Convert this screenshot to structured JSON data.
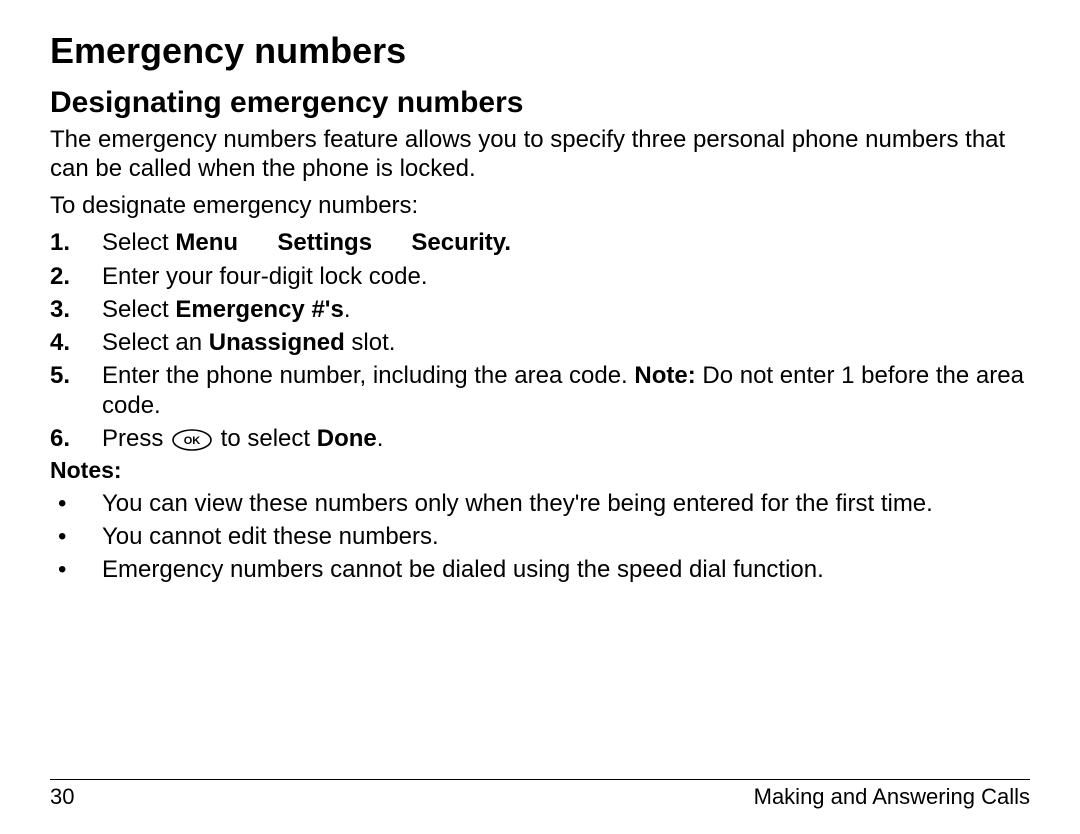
{
  "heading": "Emergency numbers",
  "subheading": "Designating emergency numbers",
  "intro1": "The emergency numbers feature allows you to specify three personal phone numbers that can be called when the phone is locked.",
  "intro2": "To designate emergency numbers:",
  "steps": [
    {
      "n": "1.",
      "parts": [
        {
          "t": "Select ",
          "b": false
        },
        {
          "t": "Menu",
          "b": true
        },
        {
          "t": "Settings",
          "b": true,
          "arrowBefore": true
        },
        {
          "t": "Security.",
          "b": true,
          "arrowBefore": true
        }
      ]
    },
    {
      "n": "2.",
      "parts": [
        {
          "t": "Enter your four-digit lock code.",
          "b": false
        }
      ]
    },
    {
      "n": "3.",
      "parts": [
        {
          "t": "Select ",
          "b": false
        },
        {
          "t": "Emergency #'s",
          "b": true
        },
        {
          "t": ".",
          "b": false
        }
      ]
    },
    {
      "n": "4.",
      "parts": [
        {
          "t": "Select an ",
          "b": false
        },
        {
          "t": "Unassigned",
          "b": true
        },
        {
          "t": " slot.",
          "b": false
        }
      ]
    },
    {
      "n": "5.",
      "parts": [
        {
          "t": "Enter the phone number, including the area code. ",
          "b": false
        },
        {
          "t": "Note:",
          "b": true
        },
        {
          "t": " Do not enter 1 before the area code.",
          "b": false
        }
      ]
    },
    {
      "n": "6.",
      "parts": [
        {
          "t": "Press ",
          "b": false
        },
        {
          "t": "OK_ICON",
          "icon": true
        },
        {
          "t": " to select ",
          "b": false
        },
        {
          "t": "Done",
          "b": true
        },
        {
          "t": ".",
          "b": false
        }
      ]
    }
  ],
  "notesLabel": "Notes:",
  "notes": [
    "You can view these numbers only when they're being entered for the first time.",
    "You cannot edit these numbers.",
    "Emergency numbers cannot be dialed using the speed dial function."
  ],
  "footer": {
    "pageNumber": "30",
    "sectionTitle": "Making and Answering Calls"
  },
  "icons": {
    "ok": "ok-button-icon"
  }
}
